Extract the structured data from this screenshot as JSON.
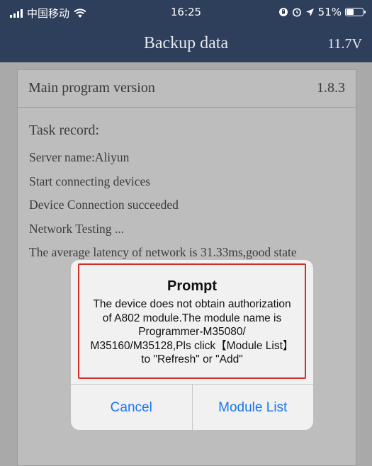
{
  "status_bar": {
    "carrier": "中国移动",
    "time": "16:25",
    "battery": "51%",
    "battery_level": 0.51
  },
  "navbar": {
    "title": "Backup data",
    "voltage": "11.7V"
  },
  "info": {
    "version_label": "Main program version",
    "version_value": "1.8.3"
  },
  "task_record": {
    "title": "Task record:",
    "lines": [
      "Server name:Aliyun",
      "Start connecting devices",
      "Device Connection succeeded",
      "Network Testing ...",
      "The average latency of network is 31.33ms,good state"
    ]
  },
  "dialog": {
    "title": "Prompt",
    "message": "The device does not obtain authorization of A802 module.The module name is Programmer-M35080/ M35160/M35128,Pls click【Module List】 to \"Refresh\" or \"Add\"",
    "cancel_label": "Cancel",
    "confirm_label": "Module List"
  },
  "colors": {
    "navbar": "#2e3f5c",
    "overlay": "#a9a9a9",
    "dialog_button": "#1677f2",
    "highlight": "#d0302a"
  }
}
